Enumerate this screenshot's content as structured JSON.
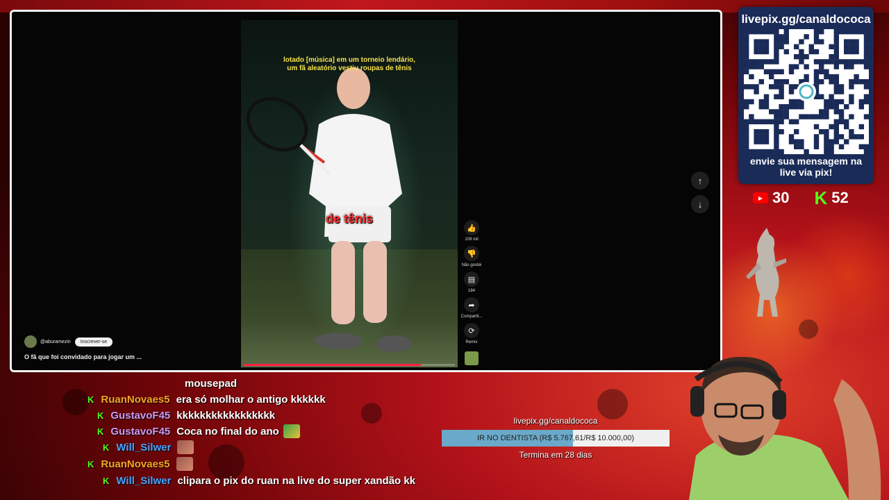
{
  "video": {
    "caption_top_line1": "lotado [música] em um torneio lendário,",
    "caption_top_line2": "um fã aleatório vestiu roupas de tênis",
    "caption_mid": "de tênis",
    "progress_fraction": 0.84,
    "channel_name": "@aburamezin",
    "subscribe_label": "Inscrever-se",
    "title": "O fã que foi convidado para jogar um ..."
  },
  "actions": {
    "like_count": "109 mil",
    "dislike_label": "Não gostei",
    "comment_count": "184",
    "share_label": "Compartil...",
    "remix_label": "Remix"
  },
  "qr": {
    "url": "livepix.gg/canaldococa",
    "message_line1": "envie sua mensagem na",
    "message_line2": "live via pix!"
  },
  "counters": {
    "youtube_label": "▶",
    "youtube_count": "30",
    "kick_label": "K",
    "kick_count": "52"
  },
  "chat": {
    "messages": [
      {
        "platform": "",
        "user": "",
        "user_color": "#ffffff",
        "text": "mousepad"
      },
      {
        "platform": "K",
        "user": "RuanNovaes5",
        "user_color": "#f5a623",
        "text": "era só molhar o antigo kkkkkk"
      },
      {
        "platform": "K",
        "user": "GustavoF45",
        "user_color": "#c89bf2",
        "text": "kkkkkkkkkkkkkkkkk"
      },
      {
        "platform": "K",
        "user": "GustavoF45",
        "user_color": "#c89bf2",
        "text": "Coca no final do ano"
      },
      {
        "platform": "K",
        "user": "Will_Silwer",
        "user_color": "#4aa3ff",
        "text": ""
      },
      {
        "platform": "K",
        "user": "RuanNovaes5",
        "user_color": "#f5a623",
        "text": ""
      },
      {
        "platform": "K",
        "user": "Will_Silwer",
        "user_color": "#4aa3ff",
        "text": "clipara o pix do ruan na live do super xandão kk"
      }
    ]
  },
  "goal": {
    "url": "livepix.gg/canaldococa",
    "label": "IR NO DENTISTA (R$ 5.767,61/R$ 10.000,00)",
    "progress_fraction": 0.5768,
    "ends": "Termina em 28 dias"
  },
  "colors": {
    "kick_green": "#53fc18",
    "youtube_red": "#ff0000",
    "qr_panel": "#1b2b58",
    "goal_fill": "#6aa9c9"
  }
}
